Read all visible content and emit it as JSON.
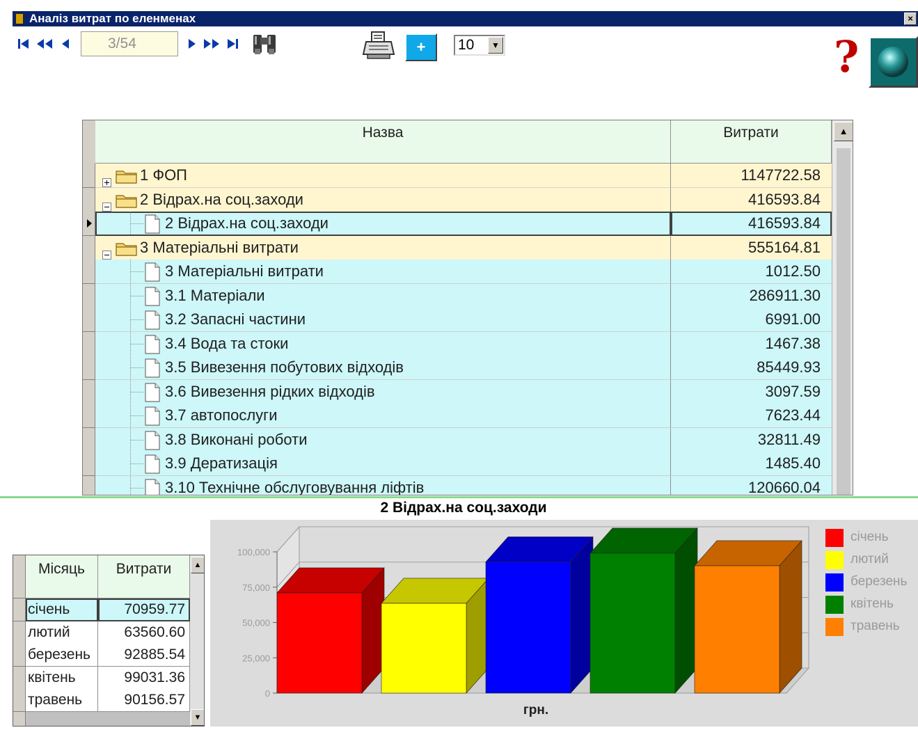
{
  "window": {
    "title": "Аналіз витрат по еленменах",
    "close_glyph": "×"
  },
  "toolbar": {
    "record_position": "3/54",
    "page_size": "10",
    "add_label": "+",
    "help_glyph": "?"
  },
  "grid": {
    "headers": [
      "Назва",
      "Витрати"
    ],
    "rows": [
      {
        "name": "1 ФОП",
        "value": "1147722.58",
        "kind": "folder",
        "toggle": "+",
        "level": 0
      },
      {
        "name": "2 Відрах.на соц.заходи",
        "value": "416593.84",
        "kind": "folder",
        "toggle": "−",
        "level": 0
      },
      {
        "name": "2 Відрах.на соц.заходи",
        "value": "416593.84",
        "kind": "leaf",
        "level": 1,
        "selected": true
      },
      {
        "name": "3 Матеріальні витрати",
        "value": "555164.81",
        "kind": "folder",
        "toggle": "−",
        "level": 0
      },
      {
        "name": "3 Матеріальні витрати",
        "value": "1012.50",
        "kind": "leaf",
        "level": 1
      },
      {
        "name": "3.1 Матеріали",
        "value": "286911.30",
        "kind": "leaf",
        "level": 1
      },
      {
        "name": "3.2 Запасні частини",
        "value": "6991.00",
        "kind": "leaf",
        "level": 1
      },
      {
        "name": "3.4 Вода та стоки",
        "value": "1467.38",
        "kind": "leaf",
        "level": 1
      },
      {
        "name": "3.5 Вивезення побутових відходів",
        "value": "85449.93",
        "kind": "leaf",
        "level": 1
      },
      {
        "name": "3.6 Вивезення рідких відходів",
        "value": "3097.59",
        "kind": "leaf",
        "level": 1
      },
      {
        "name": "3.7 автопослуги",
        "value": "7623.44",
        "kind": "leaf",
        "level": 1
      },
      {
        "name": "3.8 Виконані роботи",
        "value": "32811.49",
        "kind": "leaf",
        "level": 1
      },
      {
        "name": "3.9 Дератизація",
        "value": "1485.40",
        "kind": "leaf",
        "level": 1
      },
      {
        "name": "3.10 Технічне обслуговування ліфтів",
        "value": "120660.04",
        "kind": "leaf",
        "level": 1
      }
    ]
  },
  "monthly": {
    "headers": [
      "Місяць",
      "Витрати"
    ],
    "rows": [
      {
        "month": "січень",
        "value": "70959.77",
        "selected": true
      },
      {
        "month": "лютий",
        "value": "63560.60"
      },
      {
        "month": "березень",
        "value": "92885.54"
      },
      {
        "month": "квітень",
        "value": "99031.36"
      },
      {
        "month": "травень",
        "value": "90156.57"
      }
    ]
  },
  "chart_data": {
    "type": "bar",
    "title": "2 Відрах.на соц.заходи",
    "xlabel": "грн.",
    "ylabel": "",
    "ylim": [
      0,
      100000
    ],
    "yticks": [
      "0",
      "25,000",
      "50,000",
      "75,000",
      "100,000"
    ],
    "series": [
      {
        "name": "січень",
        "value": 70959.77,
        "color": "#ff0000"
      },
      {
        "name": "лютий",
        "value": 63560.6,
        "color": "#ffff00"
      },
      {
        "name": "березень",
        "value": 92885.54,
        "color": "#0000ff"
      },
      {
        "name": "квітень",
        "value": 99031.36,
        "color": "#008000"
      },
      {
        "name": "травень",
        "value": 90156.57,
        "color": "#ff8000"
      }
    ],
    "legend_position": "right",
    "grid": true
  }
}
